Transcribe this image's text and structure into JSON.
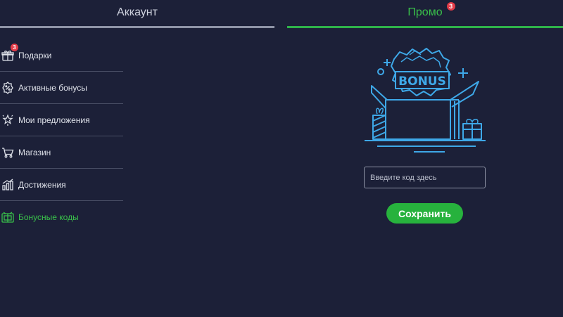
{
  "tabs": {
    "account": {
      "label": "Аккаунт"
    },
    "promo": {
      "label": "Промо",
      "badge": "3"
    }
  },
  "menu": {
    "items": [
      {
        "label": "Подарки",
        "icon": "gift-icon",
        "badge": "3"
      },
      {
        "label": "Активные бонусы",
        "icon": "bonus-badge-icon"
      },
      {
        "label": "Мои предложения",
        "icon": "offers-star-icon"
      },
      {
        "label": "Магазин",
        "icon": "cart-icon"
      },
      {
        "label": "Достижения",
        "icon": "achievements-chart-icon"
      },
      {
        "label": "Бонусные коды",
        "icon": "bonus-code-icon",
        "active": true
      }
    ]
  },
  "promo": {
    "illustration": {
      "icon": "bonus-box-illustration",
      "text": "BONUS"
    },
    "code_input": {
      "placeholder": "Введите код здесь",
      "value": ""
    },
    "save_label": "Сохранить"
  },
  "colors": {
    "background": "#1c2038",
    "accent_green": "#2fb34a",
    "badge_red": "#e43b48",
    "illustration_blue": "#3ea8e8"
  }
}
